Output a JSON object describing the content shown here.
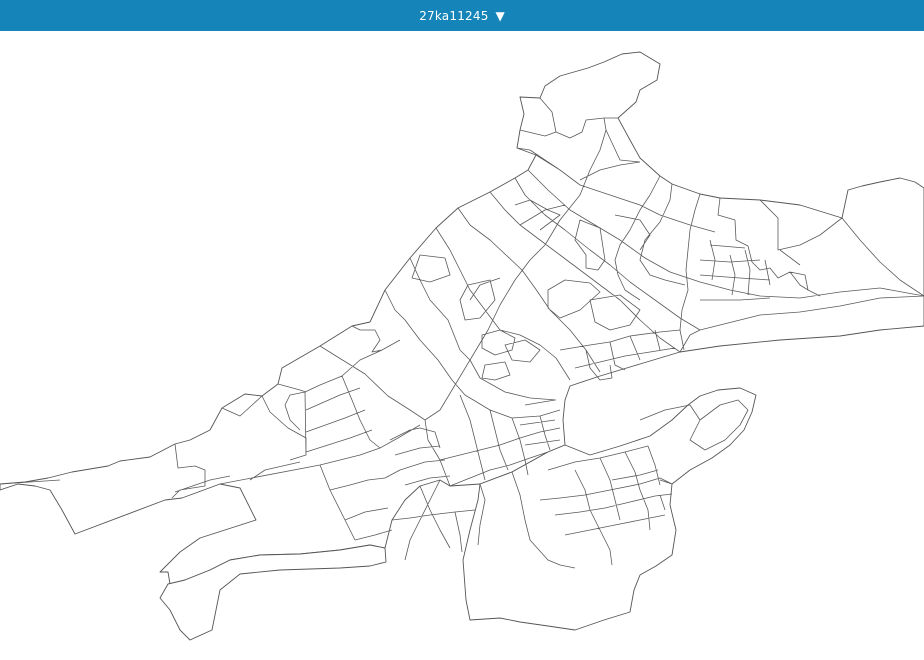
{
  "header": {
    "title": "27ka11245",
    "caret": "▼",
    "background": "#1585b9"
  },
  "map": {
    "stroke": "#5a5a5a",
    "background": "#ffffff"
  }
}
